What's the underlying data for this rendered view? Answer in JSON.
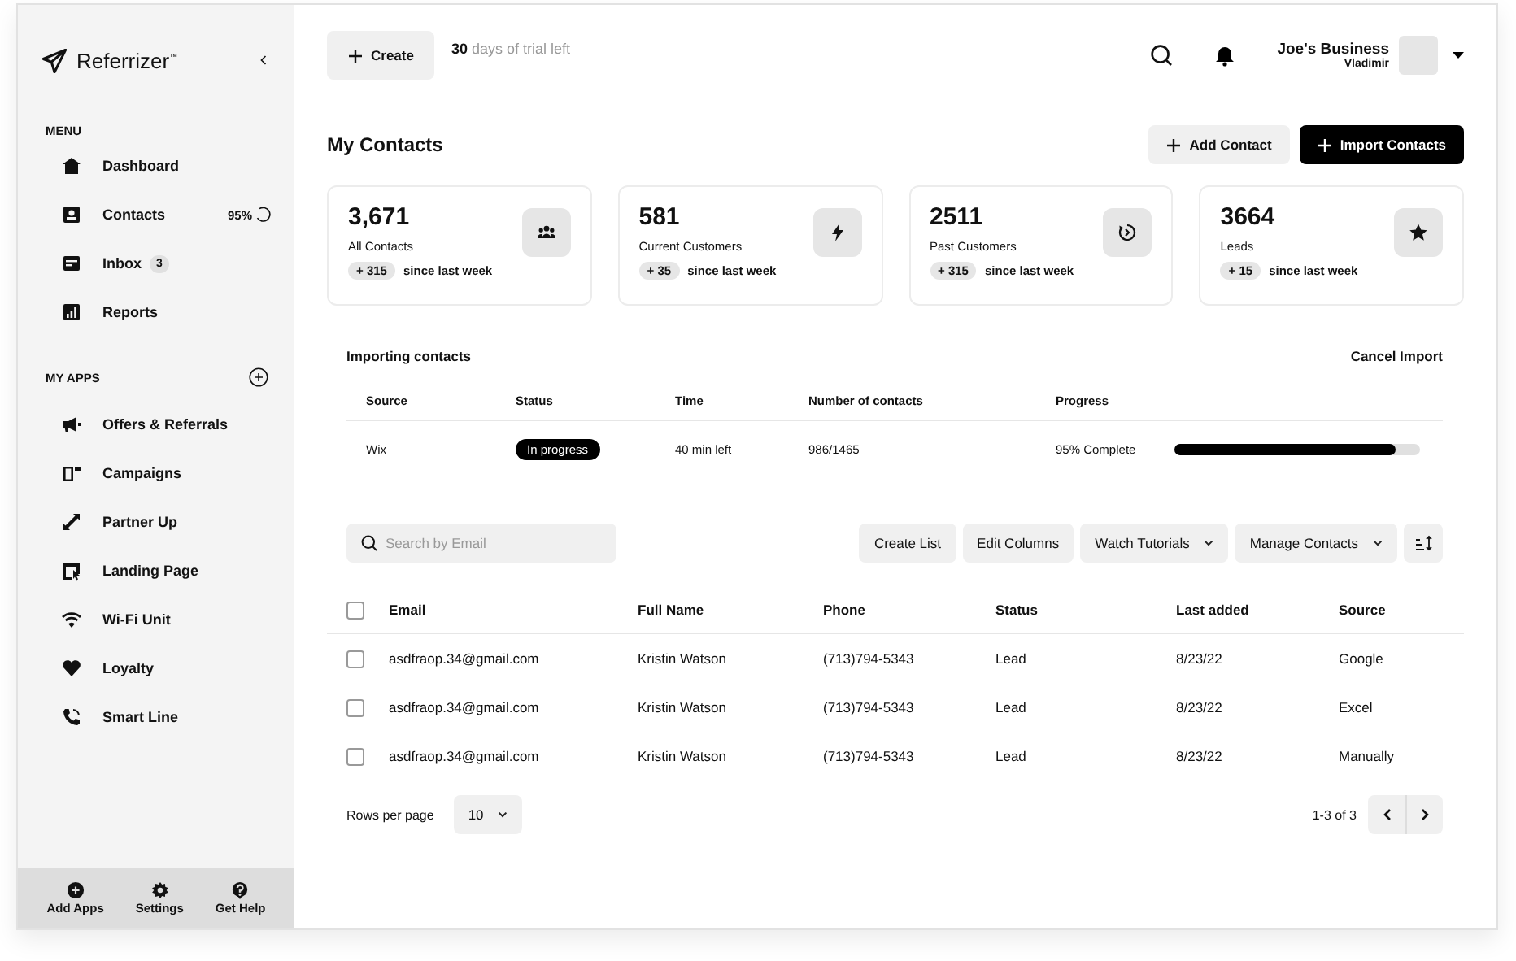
{
  "brand": {
    "name": "Referrizer$^{™}$"
  },
  "sidebar": {
    "menu_heading": "MENU",
    "menu_items": [
      {
        "label": "Dashboard"
      },
      {
        "label": "Contacts",
        "progress": "95%"
      },
      {
        "label": "Inbox",
        "badge": "3"
      },
      {
        "label": "Reports"
      }
    ],
    "apps_heading": "MY APPS",
    "app_items": [
      {
        "label": "Offers & Referrals"
      },
      {
        "label": "Campaigns"
      },
      {
        "label": "Partner Up"
      },
      {
        "label": "Landing Page"
      },
      {
        "label": "Wi-Fi Unit"
      },
      {
        "label": "Loyalty"
      },
      {
        "label": "Smart Line"
      }
    ],
    "bottom_items": [
      {
        "label": "Add Apps"
      },
      {
        "label": "Settings"
      },
      {
        "label": "Get Help"
      }
    ]
  },
  "topbar": {
    "create_button": "Create",
    "trial_days": "30",
    "trial_text": "days of trial left",
    "business": "Joe's Business",
    "user": "Vladimir"
  },
  "page": {
    "title": "My Contacts",
    "buttons": [
      {
        "label": "Add Contact",
        "kind": "secondary"
      },
      {
        "label": "Import Contacts",
        "kind": "primary"
      }
    ]
  },
  "stats": [
    {
      "value": "3,671",
      "label": "All Contacts",
      "delta": "+ 315",
      "note": "since last week"
    },
    {
      "value": "581",
      "label": "Current Customers",
      "delta": "+ 35",
      "note": "since last week"
    },
    {
      "value": "2511",
      "label": "Past Customers",
      "delta": "+ 315",
      "note": "since last week"
    },
    {
      "value": "3664",
      "label": "Leads",
      "delta": "+ 15",
      "note": "since last week"
    }
  ],
  "import": {
    "title": "Importing contacts",
    "cancel": "Cancel Import",
    "columns": [
      "Source",
      "Status",
      "Time",
      "Number of contacts",
      "Progress"
    ],
    "rows": [
      {
        "source": "Wix",
        "status": "In progress",
        "time": "40 min left",
        "count": "986/1465",
        "progress_text": "95% Complete",
        "level": 0.9
      }
    ]
  },
  "toolbar": {
    "search": {
      "placeholder": "Search by Email"
    },
    "buttons": [
      {
        "label": "Create List",
        "has_menu": false
      },
      {
        "label": "Edit Columns",
        "has_menu": false
      },
      {
        "label": "Watch Tutorials",
        "has_menu": true
      },
      {
        "label": "Manage Contacts",
        "has_menu": true
      }
    ]
  },
  "contacts": {
    "select_all": {
      "checked": false
    },
    "columns": [
      "Email",
      "Full Name",
      "Phone",
      "Status",
      "Last added",
      "Source"
    ],
    "rows": [
      {
        "checked": false,
        "email": "asdfraop.34@gmail.com",
        "name": "Kristin Watson",
        "phone": "(713)794-5343",
        "status": "Lead",
        "last_added": "8/23/22",
        "source": "Google"
      },
      {
        "checked": false,
        "email": "asdfraop.34@gmail.com",
        "name": "Kristin Watson",
        "phone": "(713)794-5343",
        "status": "Lead",
        "last_added": "8/23/22",
        "source": "Excel"
      },
      {
        "checked": false,
        "email": "asdfraop.34@gmail.com",
        "name": "Kristin Watson",
        "phone": "(713)794-5343",
        "status": "Lead",
        "last_added": "8/23/22",
        "source": "Manually"
      }
    ]
  },
  "pagination": {
    "rows_label": "Rows per page",
    "rows_value": "10",
    "range": "1-3 of 3"
  }
}
